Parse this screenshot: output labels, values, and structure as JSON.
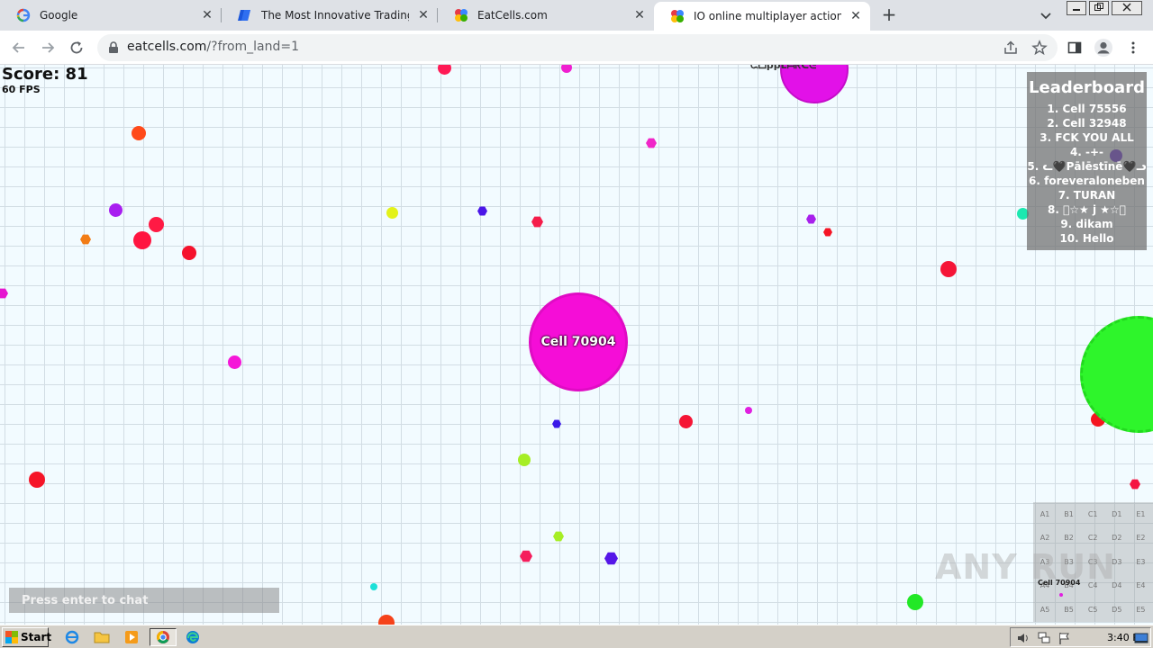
{
  "browser": {
    "tabs": [
      {
        "title": "Google",
        "active": false
      },
      {
        "title": "The Most Innovative Trading Platform",
        "active": false
      },
      {
        "title": "EatCells.com",
        "active": false
      },
      {
        "title": "IO online multiplayer action game. Sign up",
        "active": true
      }
    ],
    "new_tab_label": "+",
    "close_glyph": "✕",
    "url_domain": "eatcells.com",
    "url_rest": "/?from_land=1"
  },
  "game": {
    "score_label": "Score: 81",
    "fps_label": "60 FPS",
    "player_name": "Cell 70904",
    "top_cell_name": "ᙅᗝppᒪᗩᖇᑕᕮ",
    "leaderboard": {
      "title": "Leaderboard",
      "entries": [
        "1. Cell 75556",
        "2. Cell 32948",
        "3. FCK YOU ALL",
        "4. -+-",
        "5. ᓚ🖤Pālēstīnē🖤ᓗ",
        "6. foreveraloneben",
        "7. TURAN",
        "8. ⃝☆★ j ★☆⃝",
        "9. dikam",
        "10. Hello"
      ]
    },
    "minimap": {
      "cells": [
        [
          "A1",
          "B1",
          "C1",
          "D1",
          "E1"
        ],
        [
          "A2",
          "B2",
          "C2",
          "D2",
          "E2"
        ],
        [
          "A3",
          "B3",
          "C3",
          "D3",
          "E3"
        ],
        [
          "A4",
          "B4",
          "C4",
          "D4",
          "E4"
        ],
        [
          "A5",
          "B5",
          "C5",
          "D5",
          "E5"
        ]
      ],
      "player_label": "Cell 70904"
    },
    "watermark": "ANY RUN",
    "chat_placeholder": "Press enter to chat",
    "colors": {
      "player": "#f50dd7",
      "top_cell": "#e211e8",
      "green_cell": "#2ef52b",
      "grid": "#d2dde4",
      "background": "#f2fbff"
    }
  },
  "taskbar": {
    "start_label": "Start",
    "clock": "3:40 PM",
    "pinned": [
      "internet-explorer-icon",
      "folder-icon",
      "media-player-icon",
      "chrome-icon",
      "edge-icon"
    ]
  }
}
